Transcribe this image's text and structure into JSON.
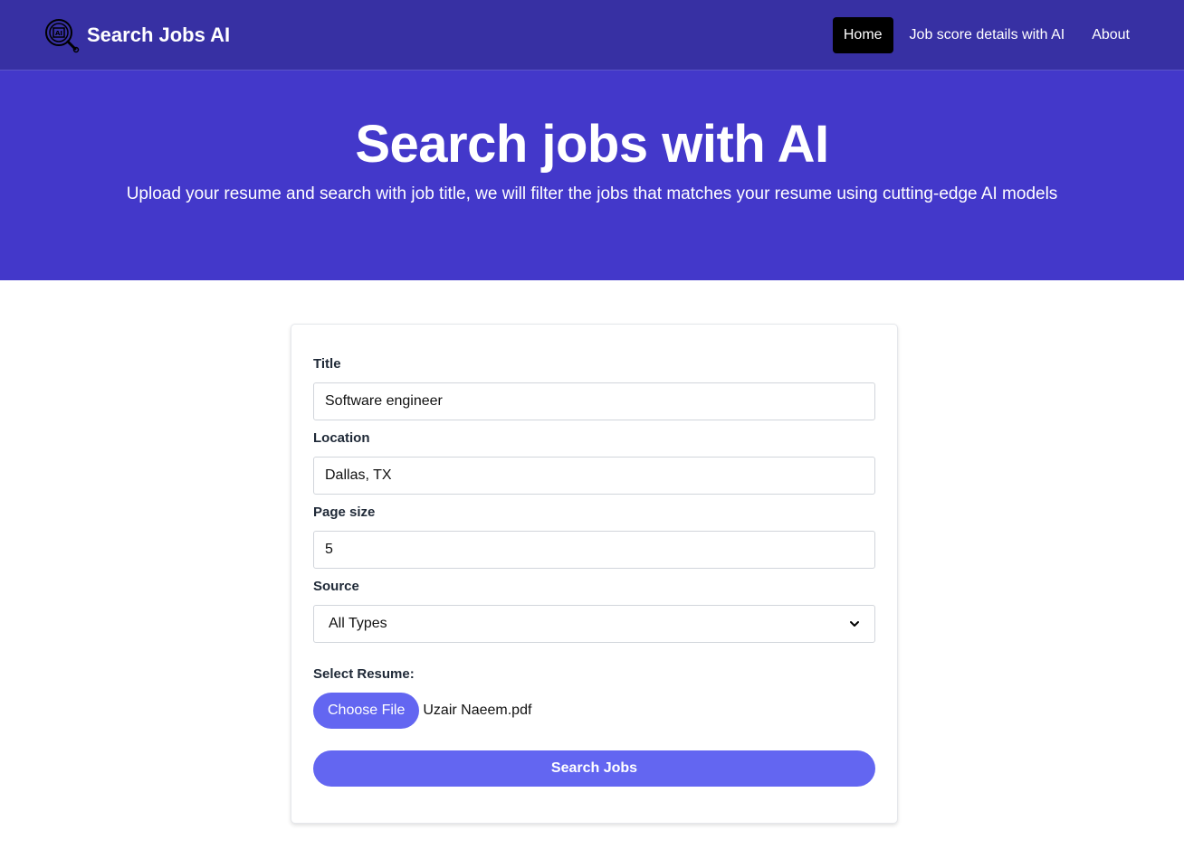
{
  "navbar": {
    "brand": "Search Jobs AI",
    "links": [
      {
        "label": "Home",
        "active": true
      },
      {
        "label": "Job score details with AI",
        "active": false
      },
      {
        "label": "About",
        "active": false
      }
    ]
  },
  "hero": {
    "title": "Search jobs with AI",
    "subtitle": "Upload your resume and search with job title, we will filter the jobs that matches your resume using cutting-edge AI models"
  },
  "form": {
    "title_label": "Title",
    "title_value": "Software engineer",
    "location_label": "Location",
    "location_value": "Dallas, TX",
    "page_size_label": "Page size",
    "page_size_value": "5",
    "source_label": "Source",
    "source_value": "All Types",
    "resume_label": "Select Resume:",
    "choose_file_label": "Choose File",
    "file_name": "Uzair Naeem.pdf",
    "submit_label": "Search Jobs"
  },
  "colors": {
    "navbar": "#3730a3",
    "hero": "#4338ca",
    "accent": "#6366f1",
    "active_link": "#000000"
  },
  "icons": {
    "brand_logo": "ai-search-icon",
    "select_arrow": "chevron-down-icon"
  }
}
